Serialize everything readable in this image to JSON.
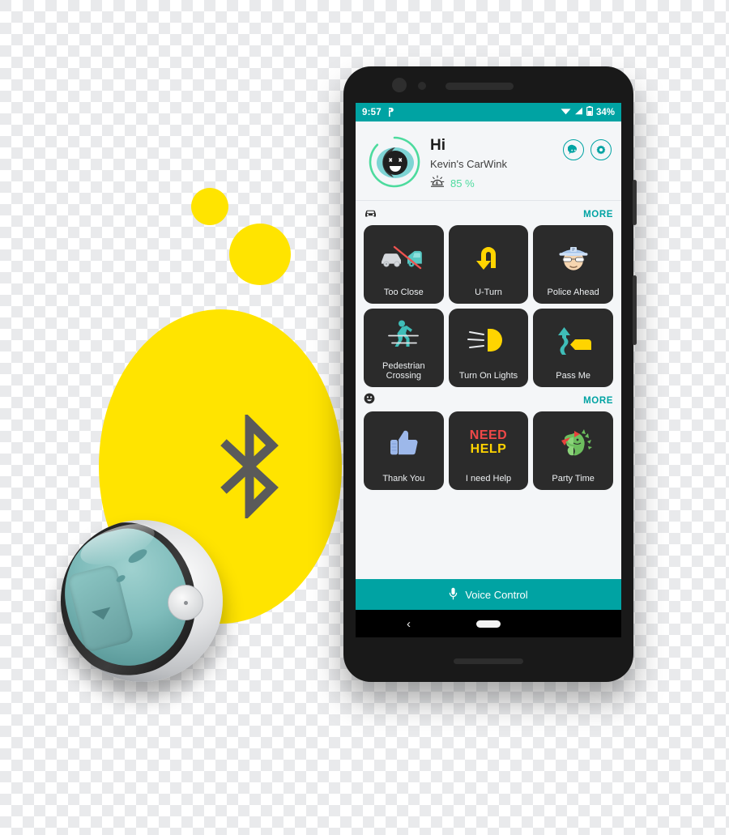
{
  "scene": {
    "colors": {
      "yellow": "#FFE400",
      "teal": "#00A3A3",
      "green": "#4DDB9E",
      "tile_bg": "#2B2B2B",
      "screen_bg": "#F4F6F8",
      "bluetooth_glyph": "#5A5A5A"
    },
    "bluetooth_icon_name": "bluetooth-logo",
    "device_name": "carwink-sphere-device"
  },
  "phone": {
    "statusbar": {
      "time": "9:57",
      "app_icon": "carwink-status-icon",
      "wifi_icon": "wifi-icon",
      "signal_icon": "cellular-signal-icon",
      "battery_icon": "battery-icon",
      "battery_percent": "34%"
    },
    "header": {
      "avatar_icon": "smiling-face-avatar",
      "greeting": "Hi",
      "device_name": "Kevin's CarWink",
      "brightness_icon": "brightness-sun-icon",
      "brightness_value": "85 %",
      "actions": [
        {
          "name": "chat-bubble-button",
          "icon": "chat-bubble-icon"
        },
        {
          "name": "settings-button",
          "icon": "gear-icon"
        }
      ]
    },
    "sections": [
      {
        "id": "driving",
        "icon": "car-icon",
        "more_label": "MORE",
        "tiles": [
          {
            "label": "Too Close",
            "icon": "two-cars-crossed-out-icon"
          },
          {
            "label": "U-Turn",
            "icon": "u-turn-arrow-icon"
          },
          {
            "label": "Police Ahead",
            "icon": "police-officer-icon"
          },
          {
            "label": "Pedestrian Crossing",
            "icon": "pedestrian-crossing-icon"
          },
          {
            "label": "Turn On Lights",
            "icon": "headlight-icon"
          },
          {
            "label": "Pass Me",
            "icon": "pass-me-arrow-car-icon"
          }
        ]
      },
      {
        "id": "social",
        "icon": "smiley-face-icon",
        "more_label": "MORE",
        "tiles": [
          {
            "label": "Thank You",
            "icon": "thumbs-up-icon"
          },
          {
            "label": "I need Help",
            "icon": "need-help-text-icon",
            "art_line1": "NEED",
            "art_line2": "HELP"
          },
          {
            "label": "Party Time",
            "icon": "party-dinosaur-icon"
          }
        ]
      }
    ],
    "voice_control": {
      "label": "Voice Control",
      "icon": "microphone-icon"
    },
    "navbar": {
      "back_icon": "back-chevron-icon",
      "home_pill": "home-pill-indicator"
    }
  }
}
